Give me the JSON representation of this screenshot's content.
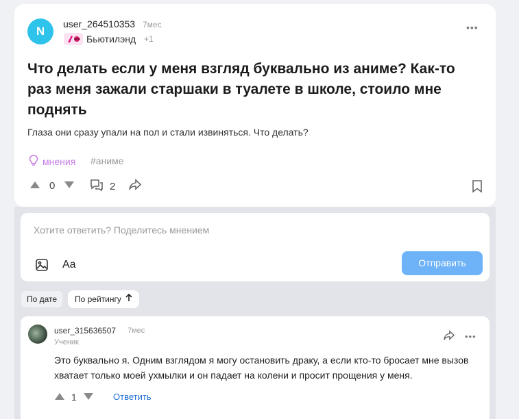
{
  "post": {
    "avatar_letter": "N",
    "author": "user_264510353",
    "time": "7мес",
    "category": "Бьютилэнд",
    "category_more": "+1",
    "title": "Что делать если у меня взгляд буквально из аниме? Как-то раз меня зажали старшаки в туалете в школе, стоило мне поднять",
    "body": "Глаза они сразу упали на пол и стали извиняться. Что делать?",
    "tags": [
      "мнения",
      "#аниме"
    ],
    "votes": "0",
    "comments": "2"
  },
  "reply": {
    "placeholder": "Хотите ответить? Поделитесь мнением",
    "format_label": "Aa",
    "send_label": "Отправить"
  },
  "sort": {
    "by_date": "По дате",
    "by_rating": "По рейтингу"
  },
  "comment": {
    "author": "user_315636507",
    "time": "7мес",
    "role": "Ученик",
    "text": "Это буквально я. Одним взглядом я могу остановить драку, а если кто-то бросает мне вызов хватает только моей ухмылки и он падает на колени и просит прощения у меня.",
    "votes": "1",
    "reply_label": "Ответить"
  },
  "colors": {
    "avatar": "#2ec3ea",
    "accent_tag": "#c77de6",
    "send_button": "#6eb2f7",
    "link": "#1f6fd8"
  }
}
